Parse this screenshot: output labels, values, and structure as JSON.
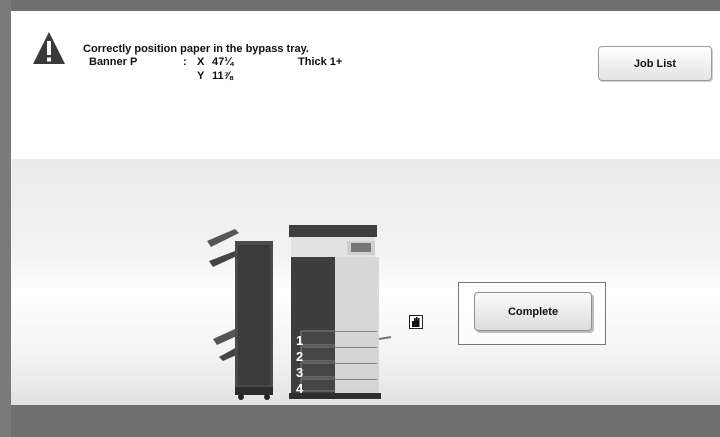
{
  "message": {
    "line1": "Correctly position paper in the bypass tray.",
    "paper_name": "Banner P",
    "separator": ":",
    "x_label": "X",
    "x_value": "47¼",
    "y_label": "Y",
    "y_value": "11⅞",
    "paper_type": "Thick 1+"
  },
  "buttons": {
    "job_list": "Job List",
    "complete": "Complete"
  },
  "trays": [
    "1",
    "2",
    "3",
    "4"
  ],
  "icons": {
    "warning": "warning-icon",
    "hand": "bypass-tray-hand-icon"
  },
  "colors": {
    "frame": "#6f6f6f",
    "panel": "#ffffff",
    "warning": "#2a2a2a"
  }
}
